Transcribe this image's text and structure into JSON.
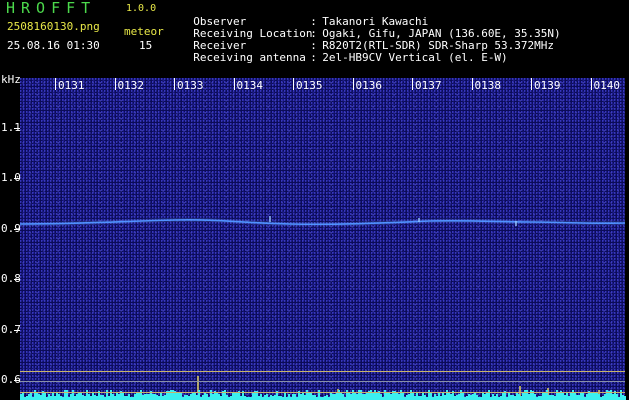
{
  "header": {
    "app_title": "HROFFT",
    "app_version": "1.0.0",
    "file_name": "2508160130.png",
    "meteor_label": "meteor",
    "date_time": "25.08.16 01:30",
    "meteor_count": "15"
  },
  "info": [
    {
      "key": "Observer",
      "sep": ":",
      "value": "Takanori Kawachi"
    },
    {
      "key": "Receiving Location",
      "sep": ":",
      "value": "Ogaki, Gifu, JAPAN (136.60E, 35.35N)"
    },
    {
      "key": "Receiver",
      "sep": ":",
      "value": "R820T2(RTL-SDR) SDR-Sharp 53.372MHz"
    },
    {
      "key": "Receiving antenna",
      "sep": ":",
      "value": "2el-HB9CV Vertical (el. E-W)"
    }
  ],
  "axes": {
    "freq_unit": "kHz",
    "freq_labels": [
      "1.1",
      "1.0",
      "0.9",
      "0.8",
      "0.7",
      "0.6"
    ],
    "time_labels": [
      "0131",
      "0132",
      "0133",
      "0134",
      "0135",
      "0136",
      "0137",
      "0138",
      "0139",
      "0140"
    ]
  },
  "colors": {
    "background": "#000000",
    "spectrogram": "#0b0b58",
    "carrier": "#4a8cff",
    "title_green": "#4cd94c",
    "label_yellow": "#e8e848",
    "level_cyan": "#3cf0f0"
  }
}
